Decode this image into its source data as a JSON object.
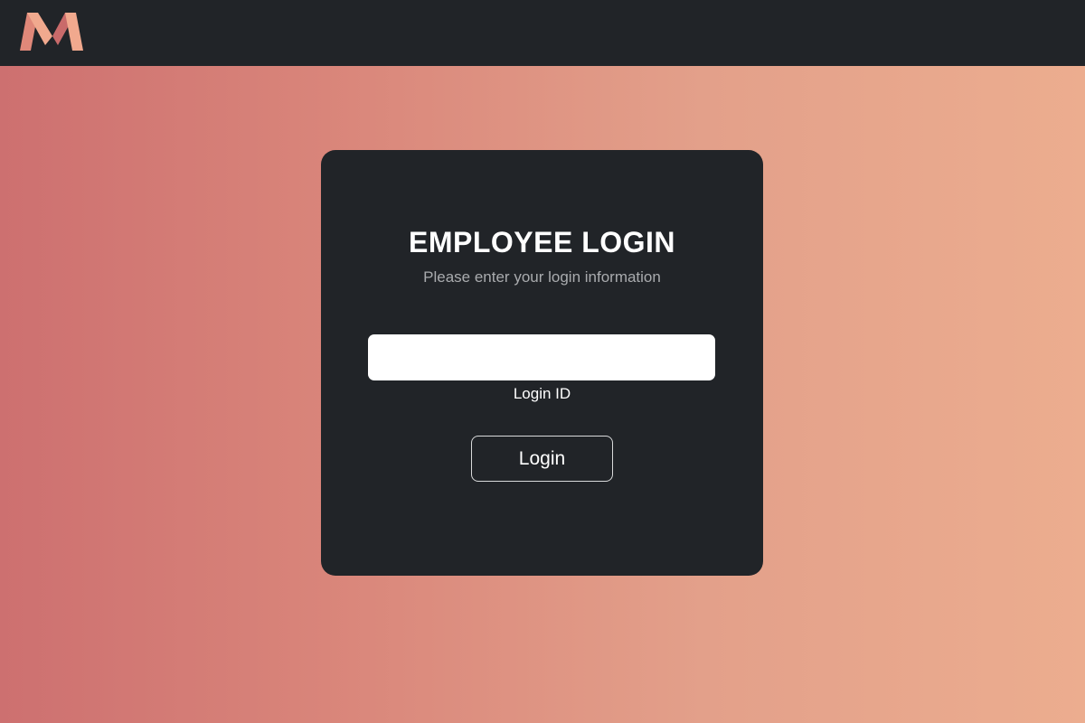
{
  "header": {
    "logo_icon": "m-logo-icon",
    "logo_colors": [
      "#f1a98e",
      "#e08879",
      "#c96a6a"
    ],
    "background": "#212428"
  },
  "login_card": {
    "title": "EMPLOYEE LOGIN",
    "subtitle": "Please enter your login information",
    "login_id_field": {
      "value": "",
      "label": "Login ID"
    },
    "login_button_label": "Login"
  },
  "colors": {
    "card_background": "#212428",
    "gradient_left": "#cd7070",
    "gradient_right": "#ecad8f"
  }
}
